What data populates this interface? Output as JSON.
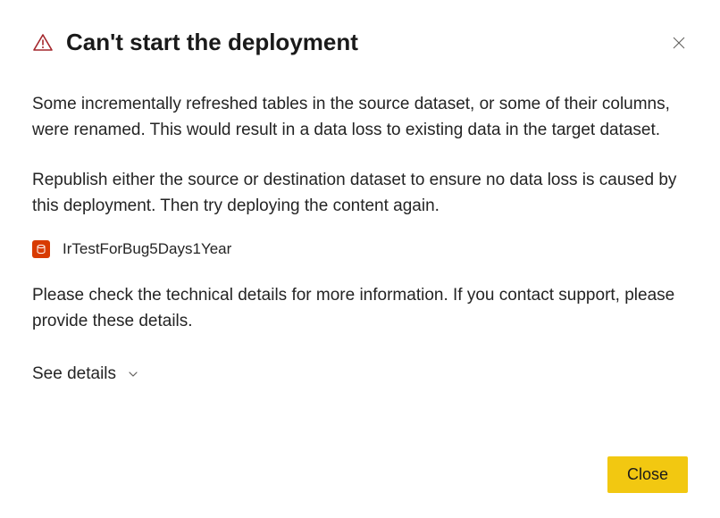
{
  "header": {
    "title": "Can't start the deployment"
  },
  "body": {
    "paragraph1": "Some incrementally refreshed tables in the source dataset, or some of their columns, were renamed. This would result in a data loss to existing data in the target dataset.",
    "paragraph2": "Republish either the source or destination dataset to ensure no data loss is caused by this deployment. Then try deploying the content again.",
    "datasetName": "IrTestForBug5Days1Year",
    "paragraph3": "Please check the technical details for more information. If you contact support, please provide these details.",
    "seeDetailsLabel": "See details"
  },
  "footer": {
    "closeLabel": "Close"
  }
}
